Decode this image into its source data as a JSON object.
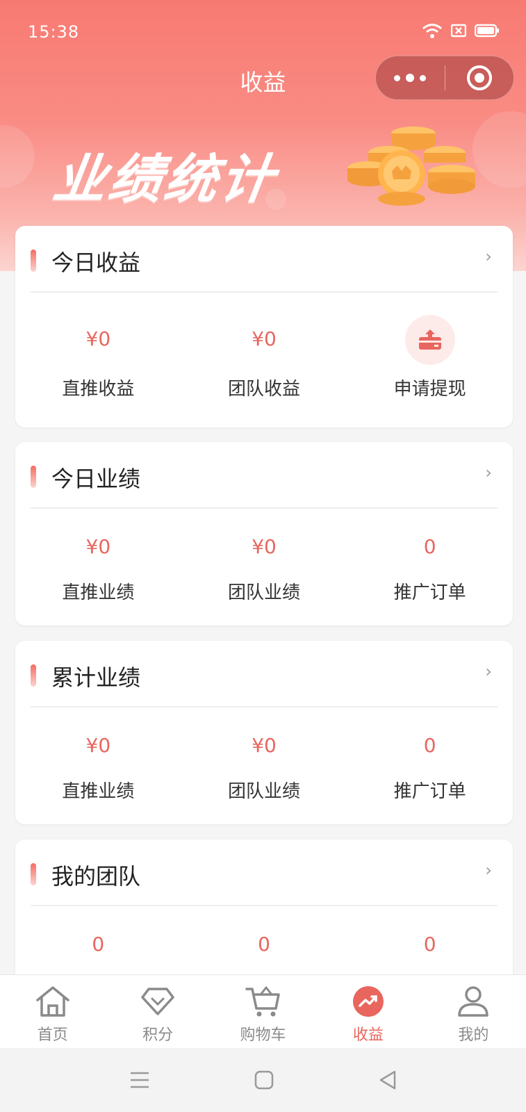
{
  "status": {
    "time": "15:38"
  },
  "nav": {
    "title": "收益"
  },
  "banner": {
    "title": "业绩统计"
  },
  "cards": [
    {
      "title": "今日收益",
      "stats": [
        {
          "value": "¥0",
          "label": "直推收益"
        },
        {
          "value": "¥0",
          "label": "团队收益"
        },
        {
          "value": "",
          "label": "申请提现",
          "icon": "withdraw-icon"
        }
      ]
    },
    {
      "title": "今日业绩",
      "stats": [
        {
          "value": "¥0",
          "label": "直推业绩"
        },
        {
          "value": "¥0",
          "label": "团队业绩"
        },
        {
          "value": "0",
          "label": "推广订单"
        }
      ]
    },
    {
      "title": "累计业绩",
      "stats": [
        {
          "value": "¥0",
          "label": "直推业绩"
        },
        {
          "value": "¥0",
          "label": "团队业绩"
        },
        {
          "value": "0",
          "label": "推广订单"
        }
      ]
    },
    {
      "title": "我的团队",
      "stats": [
        {
          "value": "0",
          "label": ""
        },
        {
          "value": "0",
          "label": ""
        },
        {
          "value": "0",
          "label": ""
        }
      ]
    }
  ],
  "tabbar": [
    {
      "label": "首页",
      "icon": "home-icon"
    },
    {
      "label": "积分",
      "icon": "diamond-icon"
    },
    {
      "label": "购物车",
      "icon": "cart-icon"
    },
    {
      "label": "收益",
      "icon": "trend-icon",
      "active": true
    },
    {
      "label": "我的",
      "icon": "user-icon"
    }
  ],
  "colors": {
    "accent": "#e8665e",
    "header": "#f77a72"
  }
}
